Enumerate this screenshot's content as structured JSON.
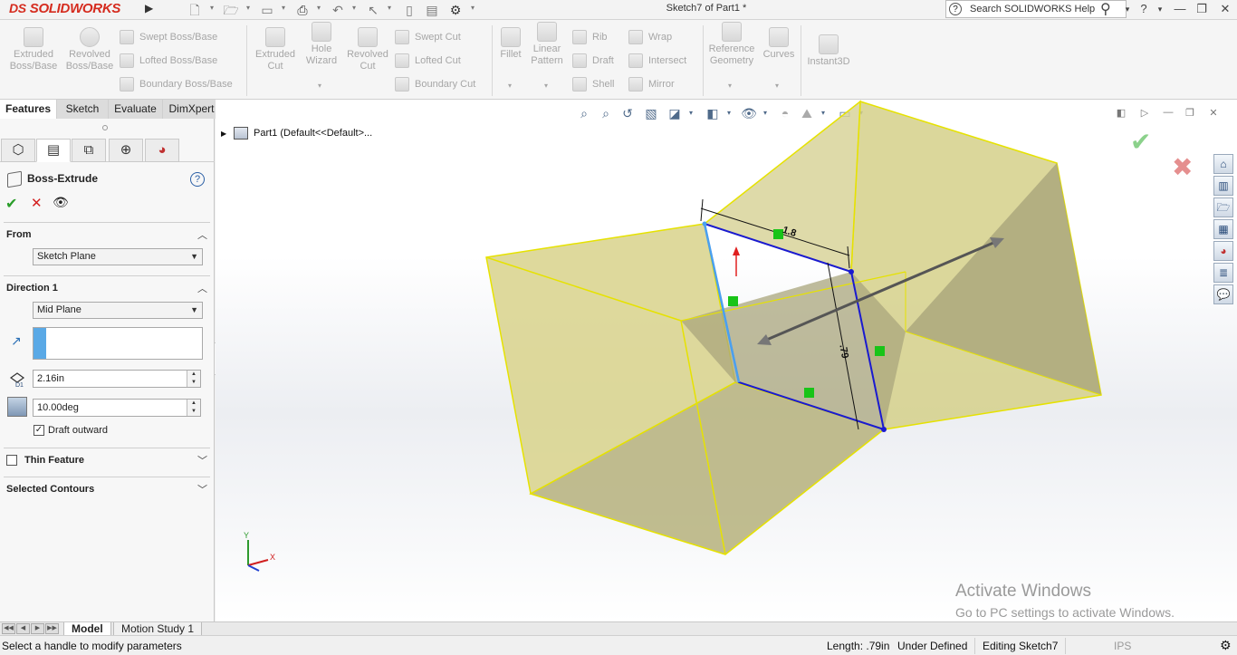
{
  "titlebar": {
    "logo_ds": "DS",
    "logo_text": "SOLIDWORKS",
    "document_title": "Sketch7 of Part1 *",
    "help_search_placeholder": "Search SOLIDWORKS Help",
    "help_question": "?"
  },
  "toolbar": {
    "extruded_boss": "Extruded\nBoss/Base",
    "revolved_boss": "Revolved\nBoss/Base",
    "swept_boss": "Swept Boss/Base",
    "lofted_boss": "Lofted Boss/Base",
    "boundary_boss": "Boundary Boss/Base",
    "extruded_cut": "Extruded\nCut",
    "hole_wizard": "Hole\nWizard",
    "revolved_cut": "Revolved\nCut",
    "swept_cut": "Swept Cut",
    "lofted_cut": "Lofted Cut",
    "boundary_cut": "Boundary Cut",
    "fillet": "Fillet",
    "linear_pattern": "Linear\nPattern",
    "rib": "Rib",
    "draft": "Draft",
    "shell": "Shell",
    "wrap": "Wrap",
    "intersect": "Intersect",
    "mirror": "Mirror",
    "reference_geometry": "Reference\nGeometry",
    "curves": "Curves",
    "instant3d": "Instant3D"
  },
  "cm_tabs": [
    "Features",
    "Sketch",
    "Evaluate",
    "DimXpert"
  ],
  "property_manager": {
    "title": "Boss-Extrude",
    "from": {
      "label": "From",
      "value": "Sketch Plane"
    },
    "direction1": {
      "label": "Direction 1",
      "end_condition": "Mid Plane",
      "depth": "2.16in",
      "draft_angle": "10.00deg",
      "draft_outward_label": "Draft outward",
      "draft_outward_checked": true
    },
    "thin_feature": {
      "label": "Thin Feature",
      "checked": false
    },
    "selected_contours": {
      "label": "Selected Contours"
    }
  },
  "graphics": {
    "tree_root": "Part1  (Default<<Default>...",
    "watermark_title": "Activate Windows",
    "watermark_sub": "Go to PC settings to activate Windows.",
    "dim_top": "1.8",
    "dim_right": ".79",
    "triad_x": "X",
    "triad_y": "Y"
  },
  "bottom_tabs": [
    "Model",
    "Motion Study 1"
  ],
  "status": {
    "message": "Select a handle to modify parameters",
    "length": "Length: .79in",
    "sketch_state": "Under Defined",
    "editing": "Editing Sketch7",
    "units": "IPS"
  }
}
